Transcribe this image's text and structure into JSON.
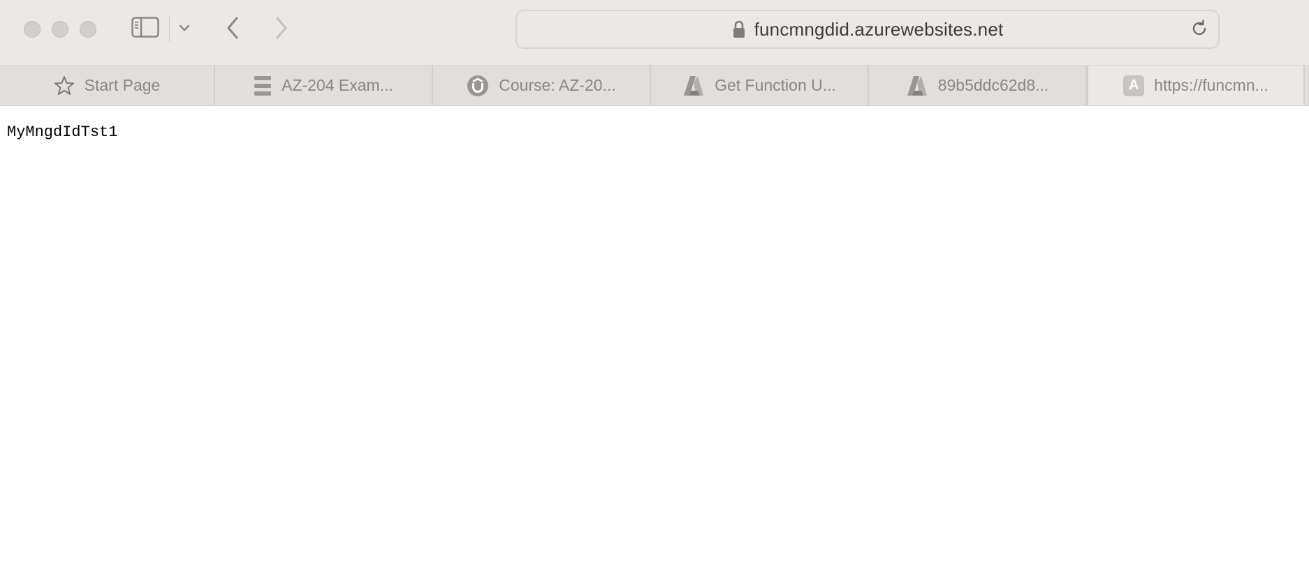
{
  "browser": {
    "address_bar": {
      "url": "funcmngdid.azurewebsites.net"
    },
    "tabs": [
      {
        "label": "Start Page",
        "icon": "star-icon",
        "active": false
      },
      {
        "label": "AZ-204 Exam...",
        "icon": "menu-lines-icon",
        "active": false
      },
      {
        "label": "Course: AZ-20...",
        "icon": "udemy-icon",
        "active": false
      },
      {
        "label": "Get Function U...",
        "icon": "azure-icon",
        "active": false
      },
      {
        "label": "89b5ddc62d8...",
        "icon": "azure-icon",
        "active": false
      },
      {
        "label": "https://funcmn...",
        "icon": "a-letter-icon",
        "active": true
      }
    ],
    "tab_letter_icon": "A"
  },
  "page": {
    "body_text": "MyMngdIdTst1"
  },
  "colors": {
    "toolbar_bg": "#ece8e6",
    "tabbar_bg": "#e2dedb",
    "tab_text": "#8b8785",
    "url_text": "#3b3b3b"
  }
}
